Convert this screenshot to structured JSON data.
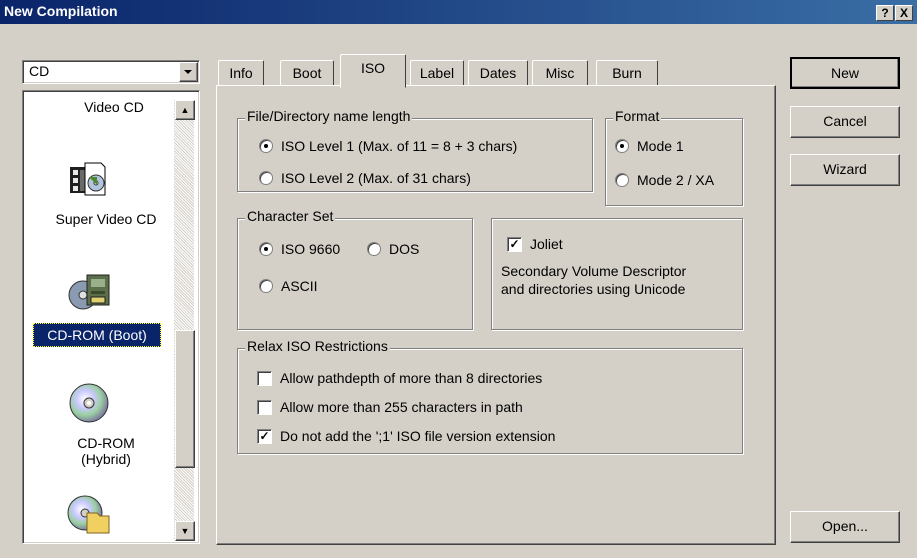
{
  "window": {
    "title": "New Compilation",
    "help_btn": "?",
    "close_btn": "X"
  },
  "media_combo": {
    "value": "CD"
  },
  "compilation_types": [
    {
      "label": "Video CD",
      "icon": "video-cd-icon",
      "selected": false
    },
    {
      "label": "Super Video CD",
      "icon": "super-video-cd-icon",
      "selected": false
    },
    {
      "label": "CD-ROM (Boot)",
      "icon": "cd-rom-boot-icon",
      "selected": true
    },
    {
      "label": "CD-ROM",
      "label2": "(Hybrid)",
      "icon": "cd-rom-hybrid-icon",
      "selected": false
    },
    {
      "label": "",
      "icon": "cd-rom-udf-icon",
      "selected": false
    }
  ],
  "tabs": [
    "Info",
    "Boot",
    "ISO",
    "Label",
    "Dates",
    "Misc",
    "Burn"
  ],
  "active_tab": "ISO",
  "iso": {
    "name_length": {
      "title": "File/Directory name length",
      "level1": "ISO Level 1 (Max. of 11 = 8 + 3 chars)",
      "level2": "ISO Level 2 (Max. of 31 chars)",
      "selected": "level1"
    },
    "format": {
      "title": "Format",
      "mode1": "Mode 1",
      "mode2": "Mode 2 / XA",
      "selected": "mode1"
    },
    "charset": {
      "title": "Character Set",
      "iso9660": "ISO 9660",
      "dos": "DOS",
      "ascii": "ASCII",
      "selected": "iso9660"
    },
    "joliet": {
      "label": "Joliet",
      "checked": true,
      "desc_line1": "Secondary Volume Descriptor",
      "desc_line2": "and directories using Unicode"
    },
    "relax": {
      "title": "Relax ISO Restrictions",
      "opt1": {
        "label": "Allow pathdepth of more than 8 directories",
        "checked": false
      },
      "opt2": {
        "label": "Allow more than 255 characters in path",
        "checked": false
      },
      "opt3": {
        "label": "Do not add the ';1' ISO file version extension",
        "checked": true
      }
    }
  },
  "buttons": {
    "new": "New",
    "cancel": "Cancel",
    "wizard": "Wizard",
    "open": "Open..."
  },
  "colors": {
    "face": "#d4d0c8",
    "title_start": "#0a246a",
    "title_end": "#3a6ea5",
    "selection": "#0a246a"
  }
}
